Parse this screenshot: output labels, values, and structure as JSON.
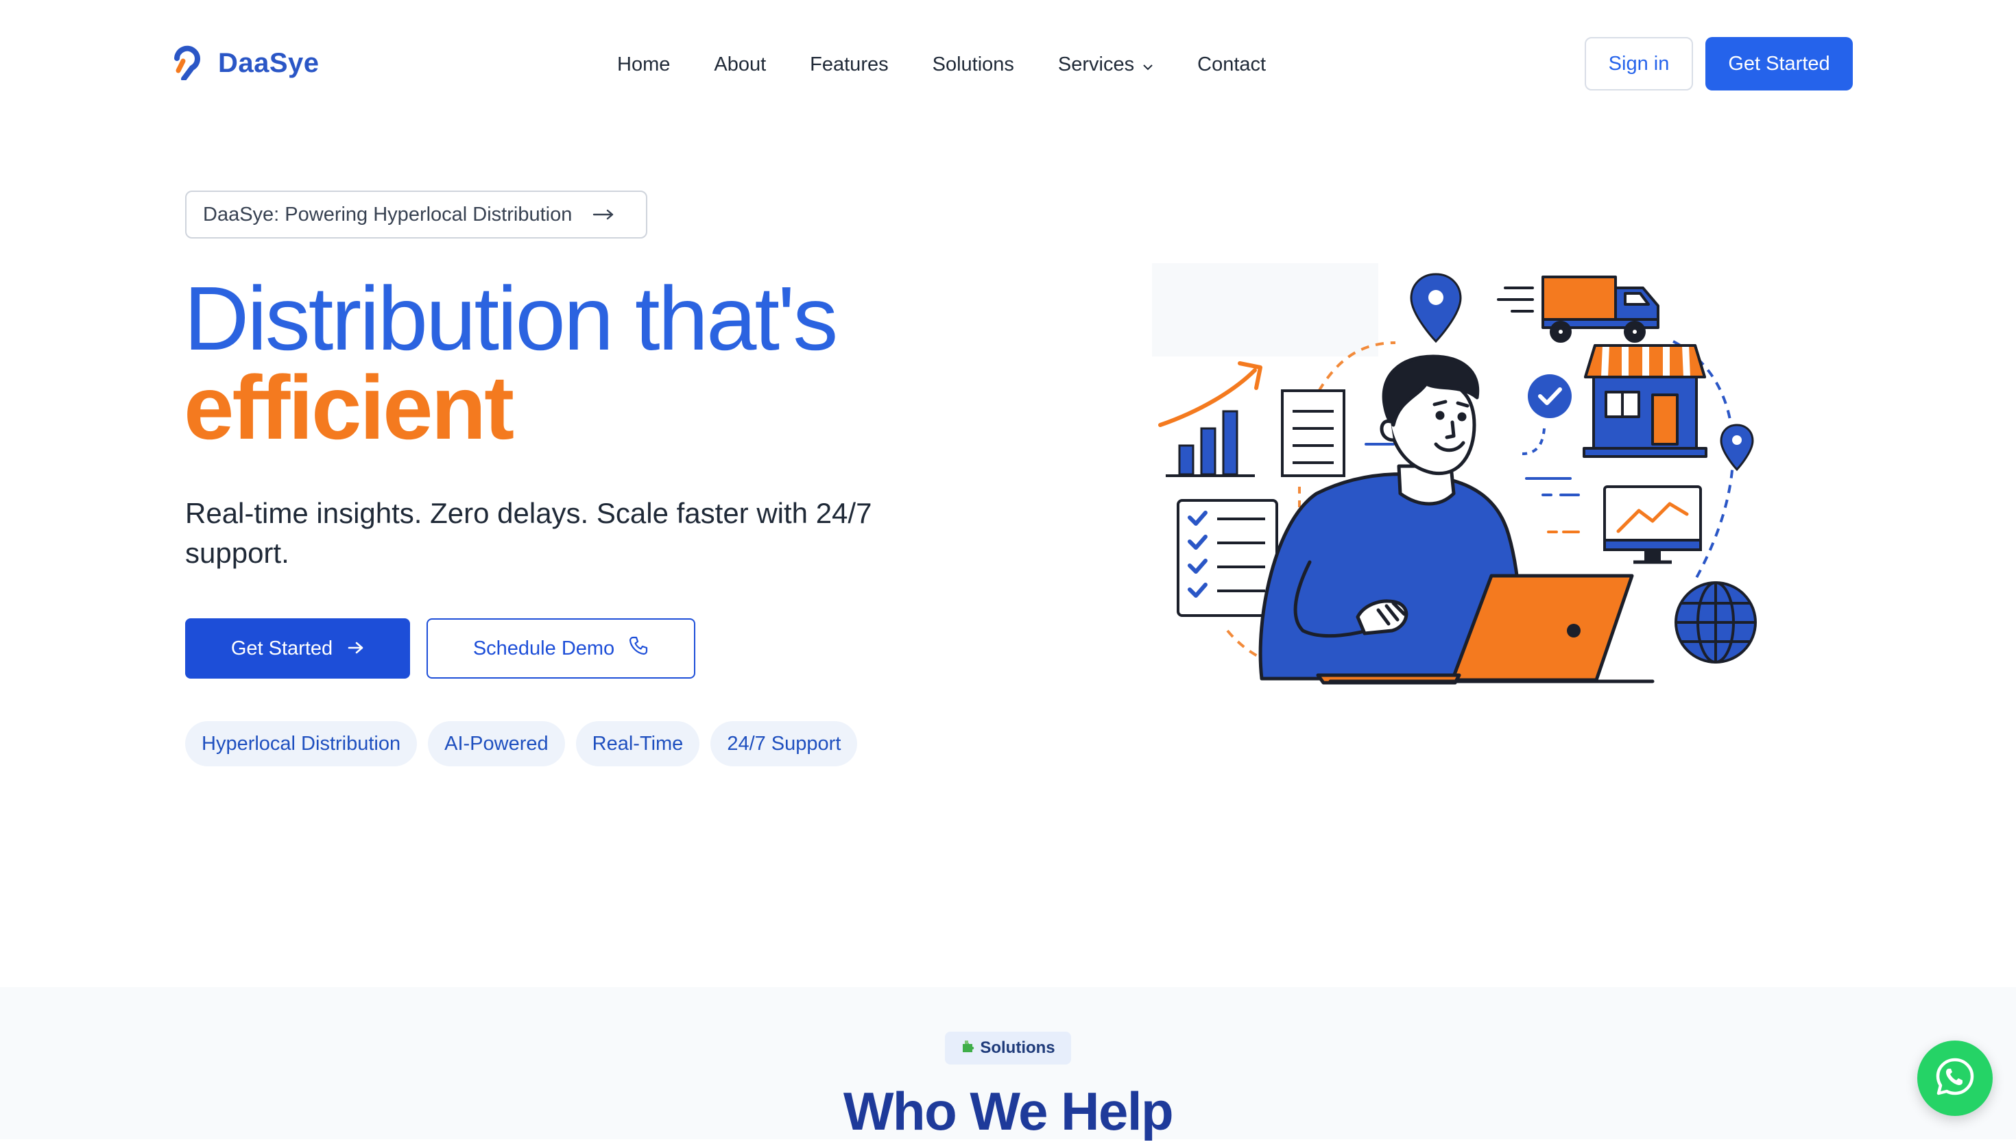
{
  "brand": {
    "name": "DaaSye"
  },
  "nav": {
    "items": [
      {
        "label": "Home"
      },
      {
        "label": "About"
      },
      {
        "label": "Features"
      },
      {
        "label": "Solutions"
      },
      {
        "label": "Services"
      },
      {
        "label": "Contact"
      }
    ]
  },
  "header": {
    "signin_label": "Sign in",
    "get_started_label": "Get Started"
  },
  "hero": {
    "announcement": "DaaSye: Powering Hyperlocal Distribution",
    "title_line1": "Distribution that's",
    "title_line2": "efficient",
    "subtitle": "Real-time insights. Zero delays. Scale faster with 24/7 support.",
    "primary_cta": "Get Started",
    "secondary_cta": "Schedule Demo",
    "tags": [
      "Hyperlocal Distribution",
      "AI-Powered",
      "Real-Time",
      "24/7 Support"
    ]
  },
  "section": {
    "badge": "Solutions",
    "title": "Who We Help"
  },
  "colors": {
    "primary": "#2563eb",
    "accent": "#f47a1f",
    "heading": "#1e3a9a",
    "whatsapp": "#25d366"
  },
  "icons": [
    "logo-icon",
    "chevron-down-icon",
    "arrow-right-icon",
    "phone-icon",
    "puzzle-icon",
    "whatsapp-icon"
  ]
}
